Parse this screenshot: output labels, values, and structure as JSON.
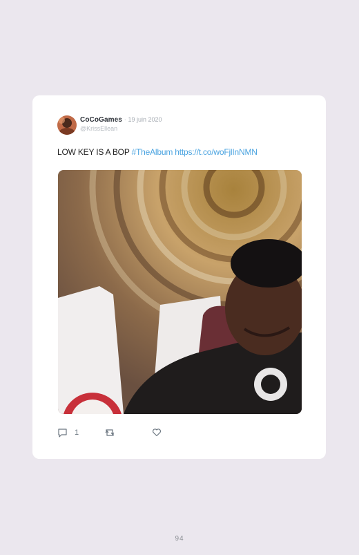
{
  "tweet": {
    "display_name": "CoCoGames",
    "separator": "·",
    "date": "19 juin 2020",
    "handle": "@KrissEllean",
    "text": "LOW KEY IS A BOP",
    "hashtag": "#TheAlbum",
    "link": "https://t.co/woFjlInNMN",
    "reply_count": "1"
  },
  "page": {
    "number": "94"
  },
  "icons": {
    "reply": "reply-icon",
    "retweet": "retweet-icon",
    "like": "heart-icon"
  }
}
